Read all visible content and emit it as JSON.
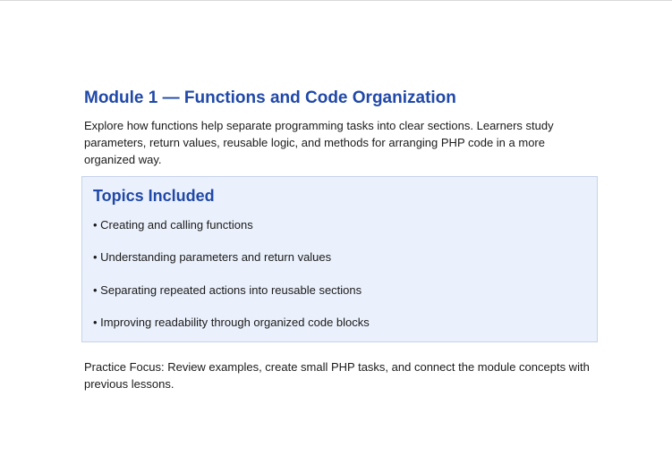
{
  "module": {
    "title": "Module 1 — Functions and Code Organization",
    "description": "Explore how functions help separate programming tasks into clear sections. Learners study parameters, return values, reusable logic, and methods for arranging PHP code in a more organized way."
  },
  "topics": {
    "heading": "Topics Included",
    "items": [
      "• Creating and calling functions",
      "• Understanding parameters and return values",
      "• Separating repeated actions into reusable sections",
      "• Improving readability through organized code blocks"
    ]
  },
  "practice": {
    "text": "Practice Focus: Review examples, create small PHP tasks, and connect the module concepts with previous lessons."
  },
  "colors": {
    "heading": "#2048a8",
    "box_background": "#ebf1fc",
    "box_border": "#c5d3ea"
  }
}
